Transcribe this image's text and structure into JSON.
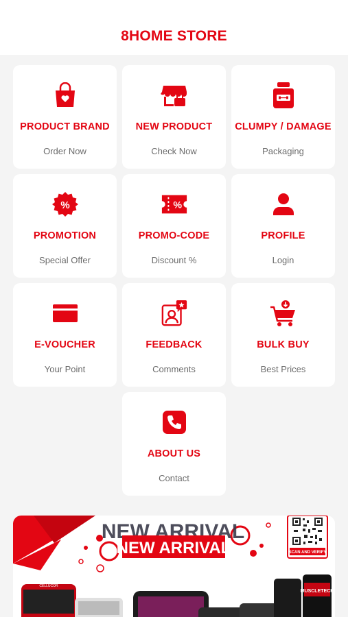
{
  "app": {
    "title": "8HOME STORE"
  },
  "tiles": [
    {
      "title": "PRODUCT BRAND",
      "sub": "Order Now",
      "icon": "shopping-bag-icon"
    },
    {
      "title": "NEW PRODUCT",
      "sub": "Check Now",
      "icon": "store-icon"
    },
    {
      "title": "CLUMPY / DAMAGE",
      "sub": "Packaging",
      "icon": "supplement-jar-icon"
    },
    {
      "title": "PROMOTION",
      "sub": "Special Offer",
      "icon": "percent-badge-icon"
    },
    {
      "title": "PROMO-CODE",
      "sub": "Discount %",
      "icon": "coupon-icon"
    },
    {
      "title": "PROFILE",
      "sub": "Login",
      "icon": "person-icon"
    },
    {
      "title": "E-VOUCHER",
      "sub": "Your Point",
      "icon": "card-icon"
    },
    {
      "title": "FEEDBACK",
      "sub": "Comments",
      "icon": "feedback-icon"
    },
    {
      "title": "BULK BUY",
      "sub": "Best Prices",
      "icon": "cart-icon"
    },
    {
      "title": "ABOUT US",
      "sub": "Contact",
      "icon": "phone-icon"
    }
  ],
  "banner": {
    "headline": "NEW ARRIVAL",
    "qr_caption": "SCAN AND VERIFY",
    "product_label": "MUSCLETECH",
    "product_label_2": "CELLUCOR"
  },
  "colors": {
    "accent": "#e30613",
    "background": "#f4f4f4",
    "card": "#ffffff",
    "subtext": "#6b6b6b"
  }
}
